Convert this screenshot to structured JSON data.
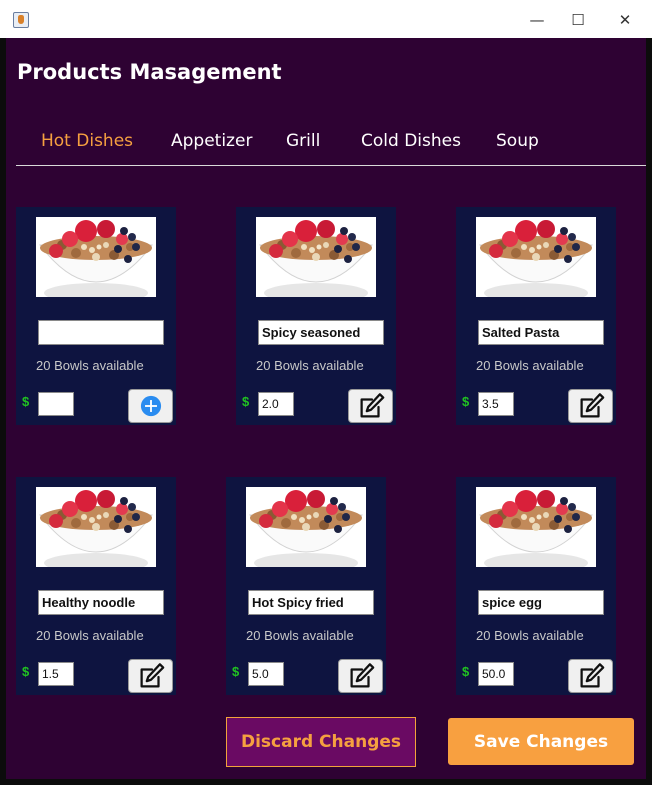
{
  "window": {
    "controls": {
      "minimize": "—",
      "maximize": "☐",
      "close": "✕"
    }
  },
  "header": {
    "title": "Products Masagement"
  },
  "tabs": [
    {
      "label": "Hot Dishes",
      "active": true
    },
    {
      "label": "Appetizer",
      "active": false
    },
    {
      "label": "Grill",
      "active": false
    },
    {
      "label": "Cold Dishes",
      "active": false
    },
    {
      "label": "Soup",
      "active": false
    }
  ],
  "cards": [
    {
      "name": "",
      "availability": "20 Bowls available",
      "currency": "$",
      "price": "",
      "action_icon": "add-icon"
    },
    {
      "name": "Spicy seasoned",
      "availability": "20 Bowls available",
      "currency": "$",
      "price": "2.0",
      "action_icon": "edit-icon"
    },
    {
      "name": "Salted Pasta",
      "availability": "20 Bowls available",
      "currency": "$",
      "price": "3.5",
      "action_icon": "edit-icon"
    },
    {
      "name": "Healthy noodle",
      "availability": "20 Bowls available",
      "currency": "$",
      "price": "1.5",
      "action_icon": "edit-icon"
    },
    {
      "name": "Hot Spicy fried",
      "availability": "20 Bowls available",
      "currency": "$",
      "price": "5.0",
      "action_icon": "edit-icon"
    },
    {
      "name": "spice egg",
      "availability": "20 Bowls available",
      "currency": "$",
      "price": "50.0",
      "action_icon": "edit-icon"
    }
  ],
  "footer": {
    "discard_label": "Discard Changes",
    "save_label": "Save Changes"
  },
  "colors": {
    "background": "#2e0233",
    "card": "#0e1440",
    "accent": "#f5a040",
    "discard_bg": "#6a0a63",
    "dollar": "#21c221",
    "add_icon": "#2a8cf0"
  }
}
